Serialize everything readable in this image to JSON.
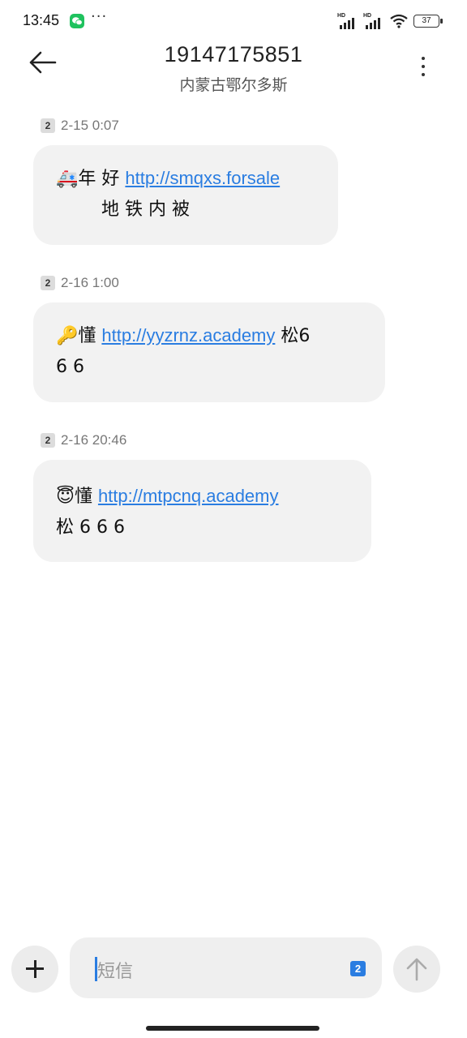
{
  "status_bar": {
    "time": "13:45",
    "dots": "···",
    "signal1_label": "HD",
    "signal2_label": "HD",
    "battery": "37",
    "icons": [
      "wechat-icon",
      "signal-icon",
      "signal-icon",
      "wifi-icon",
      "battery-icon"
    ]
  },
  "header": {
    "title": "19147175851",
    "subtitle": "内蒙古鄂尔多斯",
    "back_icon": "arrow-left-icon",
    "more_icon": "more-vertical-icon"
  },
  "messages": [
    {
      "sim": "2",
      "timestamp": "2-15 0:07",
      "emoji": "🚑",
      "line1_text": "年 好 ",
      "link": "http://smqxs.forsale",
      "line2_text": "　地 铁 内  被"
    },
    {
      "sim": "2",
      "timestamp": "2-16 1:00",
      "emoji": "🔑",
      "line1_text": "懂 ",
      "link": "http://yyzrnz.academy",
      "line1_tail": "  松6",
      "line2_text": "6 6"
    },
    {
      "sim": "2",
      "timestamp": "2-16 20:46",
      "emoji": "😇",
      "line1_text": "懂 ",
      "link": "http://mtpcnq.academy",
      "line2_text": "松 6 6 6"
    }
  ],
  "composer": {
    "placeholder": "短信",
    "sim_badge": "2",
    "add_icon": "plus-icon",
    "send_icon": "arrow-up-icon"
  },
  "colors": {
    "link": "#2a7de1",
    "bubble": "#f2f2f2",
    "wechat": "#1fc25e"
  }
}
